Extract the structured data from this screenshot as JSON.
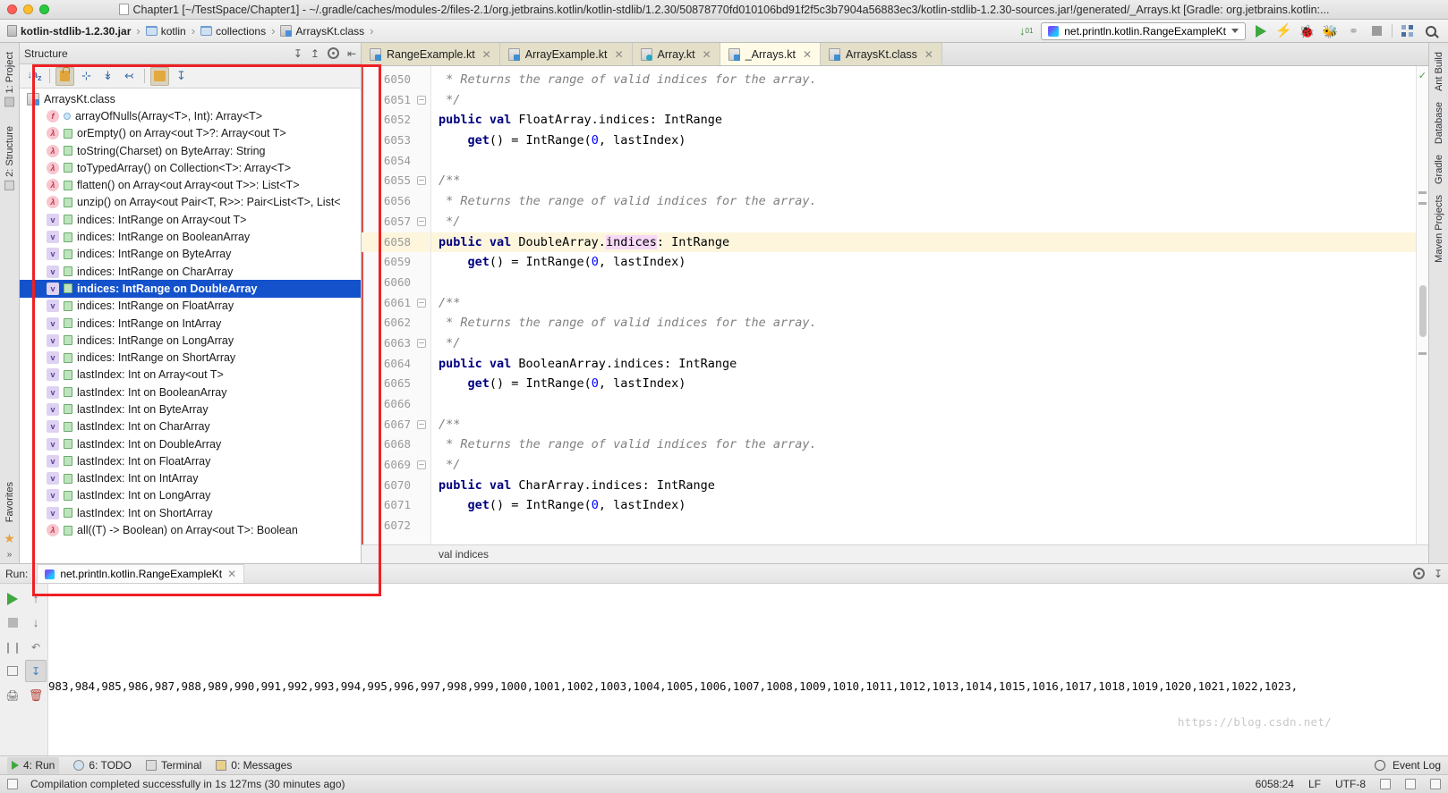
{
  "window": {
    "title": "Chapter1 [~/TestSpace/Chapter1] - ~/.gradle/caches/modules-2/files-2.1/org.jetbrains.kotlin/kotlin-stdlib/1.2.30/50878770fd010106bd91f2f5c3b7904a56883ec3/kotlin-stdlib-1.2.30-sources.jar!/generated/_Arrays.kt [Gradle: org.jetbrains.kotlin:...",
    "traffic": {
      "close": "close-window",
      "minimize": "minimize-window",
      "zoom": "zoom-window"
    }
  },
  "breadcrumb": {
    "items": [
      {
        "label": "kotlin-stdlib-1.2.30.jar",
        "icon": "jar-icon",
        "bold": true
      },
      {
        "label": "kotlin",
        "icon": "folder-icon",
        "bold": false
      },
      {
        "label": "collections",
        "icon": "folder-icon",
        "bold": false
      },
      {
        "label": "ArraysKt.class",
        "icon": "class-icon",
        "bold": false
      }
    ],
    "separator": "›"
  },
  "navbar_right": {
    "sort_icon": "sort-numeric-icon",
    "run_config": "net.println.kotlin.RangeExampleKt",
    "buttons": [
      {
        "name": "run-button",
        "icon": "play-icon"
      },
      {
        "name": "run-with-coverage-bolt-button",
        "icon": "bolt-icon"
      },
      {
        "name": "debug-button",
        "icon": "bug-icon"
      },
      {
        "name": "run-coverage-button",
        "icon": "bug-run-icon"
      },
      {
        "name": "profile-button",
        "icon": "profiler-icon"
      },
      {
        "name": "stop-button",
        "icon": "stop-icon"
      },
      {
        "name": "app-settings-button",
        "icon": "grid-icon"
      },
      {
        "name": "search-everywhere-button",
        "icon": "search-icon"
      }
    ]
  },
  "left_rail": [
    {
      "label": "1: Project",
      "icon": "project-icon"
    },
    {
      "label": "2: Structure",
      "icon": "structure-icon"
    }
  ],
  "right_rail": [
    {
      "label": "Ant Build",
      "icon": "ant-icon"
    },
    {
      "label": "Database",
      "icon": "database-icon"
    },
    {
      "label": "Gradle",
      "icon": "gradle-icon"
    },
    {
      "label": "Maven Projects",
      "icon": "maven-icon"
    }
  ],
  "bottom_rail": {
    "label": "Favorites",
    "icon": "star-icon",
    "expand": "»"
  },
  "structure": {
    "title": "Structure",
    "header_actions": [
      {
        "name": "expand-all-icon",
        "glyph": "↧"
      },
      {
        "name": "collapse-all-icon",
        "glyph": "↥"
      },
      {
        "name": "settings-gear-icon",
        "glyph": "gear"
      },
      {
        "name": "hide-panel-icon",
        "glyph": "⇤"
      }
    ],
    "toolbar": [
      {
        "name": "sort-alphabetically-button",
        "glyph": "↓ᵃᵣ",
        "active": false
      },
      {
        "name": "show-non-public-button",
        "glyph": "lock",
        "active": true
      },
      {
        "name": "show-inherited-button",
        "glyph": "⑂",
        "active": false
      },
      {
        "name": "expand-all-button",
        "glyph": "⤓",
        "active": false
      },
      {
        "name": "collapse-all-button",
        "glyph": "⤒",
        "active": false
      },
      {
        "name": "autoscroll-to-source-button",
        "glyph": "⤓box",
        "active": true
      },
      {
        "name": "autoscroll-from-source-button",
        "glyph": "⤓",
        "active": false
      }
    ],
    "root": {
      "label": "ArraysKt.class",
      "icon": "class-file-icon"
    },
    "items": [
      {
        "label": "arrayOfNulls(Array<T>, Int): Array<T>",
        "kind": "f",
        "vis": "dot",
        "selected": false
      },
      {
        "label": "orEmpty() on Array<out T>?: Array<out T>",
        "kind": "l",
        "vis": "green",
        "selected": false
      },
      {
        "label": "toString(Charset) on ByteArray: String",
        "kind": "l",
        "vis": "green",
        "selected": false
      },
      {
        "label": "toTypedArray() on Collection<T>: Array<T>",
        "kind": "l",
        "vis": "green",
        "selected": false
      },
      {
        "label": "flatten() on Array<out Array<out T>>: List<T>",
        "kind": "l",
        "vis": "green",
        "selected": false
      },
      {
        "label": "unzip() on Array<out Pair<T, R>>: Pair<List<T>, List<",
        "kind": "l",
        "vis": "green",
        "selected": false
      },
      {
        "label": "indices: IntRange on Array<out T>",
        "kind": "v",
        "vis": "green",
        "selected": false
      },
      {
        "label": "indices: IntRange on BooleanArray",
        "kind": "v",
        "vis": "green",
        "selected": false
      },
      {
        "label": "indices: IntRange on ByteArray",
        "kind": "v",
        "vis": "green",
        "selected": false
      },
      {
        "label": "indices: IntRange on CharArray",
        "kind": "v",
        "vis": "green",
        "selected": false
      },
      {
        "label": "indices: IntRange on DoubleArray",
        "kind": "v",
        "vis": "green",
        "selected": true
      },
      {
        "label": "indices: IntRange on FloatArray",
        "kind": "v",
        "vis": "green",
        "selected": false
      },
      {
        "label": "indices: IntRange on IntArray",
        "kind": "v",
        "vis": "green",
        "selected": false
      },
      {
        "label": "indices: IntRange on LongArray",
        "kind": "v",
        "vis": "green",
        "selected": false
      },
      {
        "label": "indices: IntRange on ShortArray",
        "kind": "v",
        "vis": "green",
        "selected": false
      },
      {
        "label": "lastIndex: Int on Array<out T>",
        "kind": "v",
        "vis": "green",
        "selected": false
      },
      {
        "label": "lastIndex: Int on BooleanArray",
        "kind": "v",
        "vis": "green",
        "selected": false
      },
      {
        "label": "lastIndex: Int on ByteArray",
        "kind": "v",
        "vis": "green",
        "selected": false
      },
      {
        "label": "lastIndex: Int on CharArray",
        "kind": "v",
        "vis": "green",
        "selected": false
      },
      {
        "label": "lastIndex: Int on DoubleArray",
        "kind": "v",
        "vis": "green",
        "selected": false
      },
      {
        "label": "lastIndex: Int on FloatArray",
        "kind": "v",
        "vis": "green",
        "selected": false
      },
      {
        "label": "lastIndex: Int on IntArray",
        "kind": "v",
        "vis": "green",
        "selected": false
      },
      {
        "label": "lastIndex: Int on LongArray",
        "kind": "v",
        "vis": "green",
        "selected": false
      },
      {
        "label": "lastIndex: Int on ShortArray",
        "kind": "v",
        "vis": "green",
        "selected": false
      },
      {
        "label": "all((T) -> Boolean) on Array<out T>: Boolean",
        "kind": "l",
        "vis": "green",
        "selected": false
      }
    ]
  },
  "editor": {
    "tabs": [
      {
        "label": "RangeExample.kt",
        "icon": "kotlin-file-icon",
        "active": false
      },
      {
        "label": "ArrayExample.kt",
        "icon": "kotlin-file-icon",
        "active": false
      },
      {
        "label": "Array.kt",
        "icon": "kotlin-class-icon",
        "active": false
      },
      {
        "label": "_Arrays.kt",
        "icon": "kotlin-file-icon",
        "active": true
      },
      {
        "label": "ArraysKt.class",
        "icon": "class-file-icon",
        "active": false
      }
    ],
    "first_line_number": 6050,
    "highlight_line": 6058,
    "lines": [
      {
        "n": 6050,
        "fold": "",
        "segments": [
          {
            "t": " * Returns the range of valid indices for the array.",
            "c": "cm"
          }
        ]
      },
      {
        "n": 6051,
        "fold": "–",
        "segments": [
          {
            "t": " */",
            "c": "cm"
          }
        ]
      },
      {
        "n": 6052,
        "fold": "",
        "segments": [
          {
            "t": "public val ",
            "c": "kw"
          },
          {
            "t": "FloatArray.indices: IntRange",
            "c": ""
          }
        ]
      },
      {
        "n": 6053,
        "fold": "",
        "segments": [
          {
            "t": "    ",
            "c": ""
          },
          {
            "t": "get",
            "c": "kw"
          },
          {
            "t": "() = IntRange(",
            "c": ""
          },
          {
            "t": "0",
            "c": "num"
          },
          {
            "t": ", lastIndex)",
            "c": ""
          }
        ]
      },
      {
        "n": 6054,
        "fold": "",
        "segments": [
          {
            "t": "",
            "c": ""
          }
        ]
      },
      {
        "n": 6055,
        "fold": "–",
        "segments": [
          {
            "t": "/**",
            "c": "cm"
          }
        ]
      },
      {
        "n": 6056,
        "fold": "",
        "segments": [
          {
            "t": " * Returns the range of valid indices for the array.",
            "c": "cm"
          }
        ]
      },
      {
        "n": 6057,
        "fold": "–",
        "segments": [
          {
            "t": " */",
            "c": "cm"
          }
        ]
      },
      {
        "n": 6058,
        "fold": "",
        "segments": [
          {
            "t": "public val ",
            "c": "kw"
          },
          {
            "t": "DoubleArray.",
            "c": ""
          },
          {
            "t": "indices",
            "c": "hlword"
          },
          {
            "t": ": IntRange",
            "c": ""
          }
        ]
      },
      {
        "n": 6059,
        "fold": "",
        "segments": [
          {
            "t": "    ",
            "c": ""
          },
          {
            "t": "get",
            "c": "kw"
          },
          {
            "t": "() = IntRange(",
            "c": ""
          },
          {
            "t": "0",
            "c": "num"
          },
          {
            "t": ", lastIndex)",
            "c": ""
          }
        ]
      },
      {
        "n": 6060,
        "fold": "",
        "segments": [
          {
            "t": "",
            "c": ""
          }
        ]
      },
      {
        "n": 6061,
        "fold": "–",
        "segments": [
          {
            "t": "/**",
            "c": "cm"
          }
        ]
      },
      {
        "n": 6062,
        "fold": "",
        "segments": [
          {
            "t": " * Returns the range of valid indices for the array.",
            "c": "cm"
          }
        ]
      },
      {
        "n": 6063,
        "fold": "–",
        "segments": [
          {
            "t": " */",
            "c": "cm"
          }
        ]
      },
      {
        "n": 6064,
        "fold": "",
        "segments": [
          {
            "t": "public val ",
            "c": "kw"
          },
          {
            "t": "BooleanArray.indices: IntRange",
            "c": ""
          }
        ]
      },
      {
        "n": 6065,
        "fold": "",
        "segments": [
          {
            "t": "    ",
            "c": ""
          },
          {
            "t": "get",
            "c": "kw"
          },
          {
            "t": "() = IntRange(",
            "c": ""
          },
          {
            "t": "0",
            "c": "num"
          },
          {
            "t": ", lastIndex)",
            "c": ""
          }
        ]
      },
      {
        "n": 6066,
        "fold": "",
        "segments": [
          {
            "t": "",
            "c": ""
          }
        ]
      },
      {
        "n": 6067,
        "fold": "–",
        "segments": [
          {
            "t": "/**",
            "c": "cm"
          }
        ]
      },
      {
        "n": 6068,
        "fold": "",
        "segments": [
          {
            "t": " * Returns the range of valid indices for the array.",
            "c": "cm"
          }
        ]
      },
      {
        "n": 6069,
        "fold": "–",
        "segments": [
          {
            "t": " */",
            "c": "cm"
          }
        ]
      },
      {
        "n": 6070,
        "fold": "",
        "segments": [
          {
            "t": "public val ",
            "c": "kw"
          },
          {
            "t": "CharArray.indices: IntRange",
            "c": ""
          }
        ]
      },
      {
        "n": 6071,
        "fold": "",
        "segments": [
          {
            "t": "    ",
            "c": ""
          },
          {
            "t": "get",
            "c": "kw"
          },
          {
            "t": "() = IntRange(",
            "c": ""
          },
          {
            "t": "0",
            "c": "num"
          },
          {
            "t": ", lastIndex)",
            "c": ""
          }
        ]
      },
      {
        "n": 6072,
        "fold": "",
        "segments": [
          {
            "t": "",
            "c": ""
          }
        ]
      }
    ],
    "hint": "val indices"
  },
  "run_window": {
    "label": "Run:",
    "tab": "net.println.kotlin.RangeExampleKt",
    "toolbar": [
      {
        "name": "rerun-button",
        "icon": "play-icon"
      },
      {
        "name": "scroll-up-button",
        "icon": "arrow-up-icon"
      },
      {
        "name": "stop-button",
        "icon": "stop-icon"
      },
      {
        "name": "scroll-down-button",
        "icon": "arrow-down-icon"
      },
      {
        "name": "pause-button",
        "icon": "pause-icon"
      },
      {
        "name": "soft-wrap-button",
        "icon": "wrap-icon"
      },
      {
        "name": "print-button",
        "icon": "print-icon"
      },
      {
        "name": "scroll-to-end-button",
        "icon": "scroll-end-icon"
      },
      {
        "name": "clear-all-button",
        "icon": "trash-icon"
      }
    ],
    "header_actions": [
      {
        "name": "console-settings-icon",
        "glyph": "gear"
      },
      {
        "name": "hide-window-icon",
        "glyph": "⤓"
      }
    ],
    "console_text": "983,984,985,986,987,988,989,990,991,992,993,994,995,996,997,998,999,1000,1001,1002,1003,1004,1005,1006,1007,1008,1009,1010,1011,1012,1013,1014,1015,1016,1017,1018,1019,1020,1021,1022,1023,"
  },
  "tool_strip": [
    {
      "label": "4: Run",
      "mnemonic": "4",
      "icon": "run-icon",
      "selected": true
    },
    {
      "label": "6: TODO",
      "mnemonic": "6",
      "icon": "todo-icon",
      "selected": false
    },
    {
      "label": "Terminal",
      "mnemonic": "",
      "icon": "terminal-icon",
      "selected": false
    },
    {
      "label": "0: Messages",
      "mnemonic": "0",
      "icon": "messages-icon",
      "selected": false
    }
  ],
  "event_log": {
    "label": "Event Log",
    "icon": "event-log-icon"
  },
  "status_bar": {
    "message": "Compilation completed successfully in 1s 127ms (30 minutes ago)",
    "caret": "6058:24",
    "line_separator": "LF",
    "encoding": "UTF-8",
    "icons": [
      "lock-icon",
      "inspection-icon",
      "memory-icon"
    ]
  },
  "watermark": "https://blog.csdn.net/",
  "colors": {
    "selection_blue": "#1452cc",
    "highlight_line": "#fdf6dd",
    "red_outline": "#ee2024",
    "keyword": "#000080",
    "comment": "#808080",
    "number": "#0000ff",
    "identifier_highlight": "#f7d8f7",
    "accent_green": "#3fa83f"
  }
}
